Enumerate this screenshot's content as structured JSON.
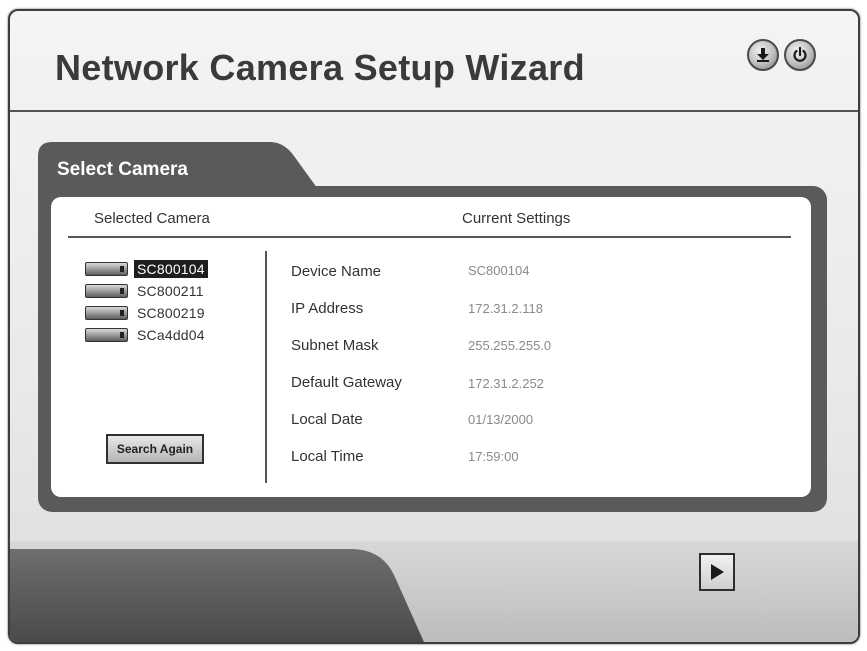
{
  "window": {
    "title": "Network Camera Setup Wizard"
  },
  "toolbar": {
    "download_icon": "download-icon",
    "power_icon": "power-icon"
  },
  "select_camera": {
    "tab_label": "Select Camera",
    "col_selected": "Selected Camera",
    "col_current": "Current Settings",
    "cameras": [
      {
        "name": "SC800104",
        "selected": true
      },
      {
        "name": "SC800211",
        "selected": false
      },
      {
        "name": "SC800219",
        "selected": false
      },
      {
        "name": "SCa4dd04",
        "selected": false
      }
    ],
    "search_again_label": "Search Again",
    "settings": [
      {
        "label": "Device Name",
        "value": "SC800104"
      },
      {
        "label": "IP Address",
        "value": "172.31.2.118"
      },
      {
        "label": "Subnet Mask",
        "value": "255.255.255.0"
      },
      {
        "label": "Default Gateway",
        "value": "172.31.2.252"
      },
      {
        "label": "Local Date",
        "value": "01/13/2000"
      },
      {
        "label": "Local Time",
        "value": "17:59:00"
      }
    ]
  },
  "navigation": {
    "next_icon": "play-next-icon"
  }
}
